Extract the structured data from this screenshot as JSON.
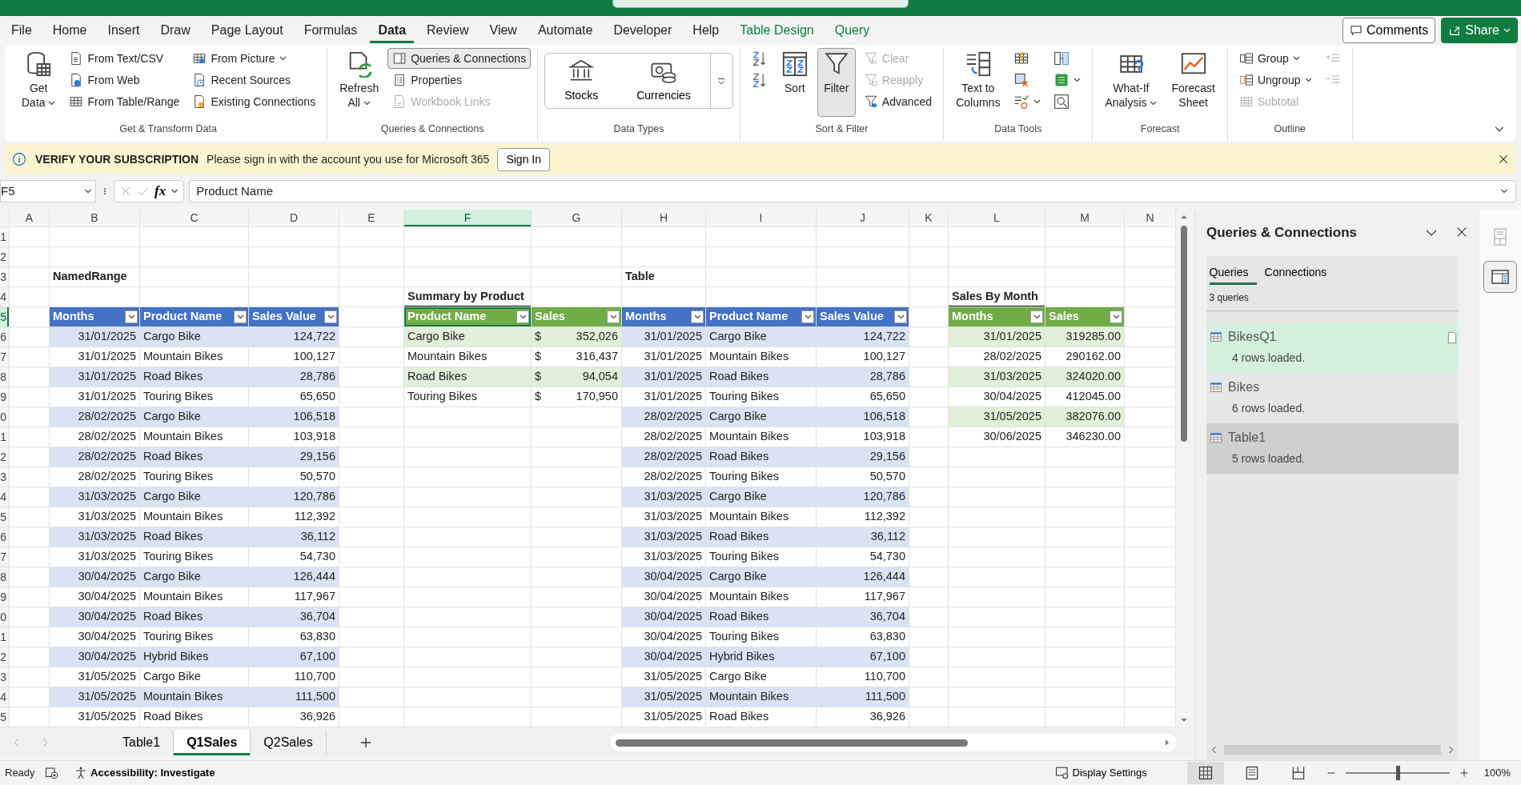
{
  "ribbon_tabs": [
    {
      "label": "File",
      "selected": false,
      "kind": "main"
    },
    {
      "label": "Home",
      "selected": false,
      "kind": "main"
    },
    {
      "label": "Insert",
      "selected": false,
      "kind": "main"
    },
    {
      "label": "Draw",
      "selected": false,
      "kind": "main"
    },
    {
      "label": "Page Layout",
      "selected": false,
      "kind": "main"
    },
    {
      "label": "Formulas",
      "selected": false,
      "kind": "main"
    },
    {
      "label": "Data",
      "selected": true,
      "kind": "main"
    },
    {
      "label": "Review",
      "selected": false,
      "kind": "main"
    },
    {
      "label": "View",
      "selected": false,
      "kind": "main"
    },
    {
      "label": "Automate",
      "selected": false,
      "kind": "main"
    },
    {
      "label": "Developer",
      "selected": false,
      "kind": "main"
    },
    {
      "label": "Help",
      "selected": false,
      "kind": "main"
    },
    {
      "label": "Table Design",
      "selected": false,
      "kind": "contextual"
    },
    {
      "label": "Query",
      "selected": false,
      "kind": "contextual"
    }
  ],
  "header_buttons": [
    {
      "label": "Comments",
      "kind": "outline"
    },
    {
      "label": "Share",
      "kind": "primary"
    }
  ],
  "ribbon_groups": [
    {
      "label": "Get & Transform Data",
      "items": [
        {
          "kind": "large",
          "lines": [
            "Get",
            "Data"
          ],
          "dropdown": true,
          "disabled": false,
          "pressed": false
        },
        {
          "kind": "small",
          "label": "From Text/CSV",
          "dropdown": false,
          "disabled": false,
          "pressed": false
        },
        {
          "kind": "small",
          "label": "From Web",
          "dropdown": false,
          "disabled": false,
          "pressed": false
        },
        {
          "kind": "small",
          "label": "From Table/Range",
          "dropdown": false,
          "disabled": false,
          "pressed": false
        },
        {
          "kind": "small",
          "label": "From Picture",
          "dropdown": true,
          "disabled": false,
          "pressed": false
        },
        {
          "kind": "small",
          "label": "Recent Sources",
          "dropdown": false,
          "disabled": false,
          "pressed": false
        },
        {
          "kind": "small",
          "label": "Existing Connections",
          "dropdown": false,
          "disabled": false,
          "pressed": false
        }
      ]
    },
    {
      "label": "Queries & Connections",
      "items": [
        {
          "kind": "large",
          "lines": [
            "Refresh",
            "All"
          ],
          "dropdown": true,
          "disabled": false,
          "pressed": false
        },
        {
          "kind": "small",
          "label": "Queries & Connections",
          "dropdown": false,
          "disabled": false,
          "pressed": true
        },
        {
          "kind": "small",
          "label": "Properties",
          "dropdown": false,
          "disabled": false,
          "pressed": false
        },
        {
          "kind": "small",
          "label": "Workbook Links",
          "dropdown": false,
          "disabled": true,
          "pressed": false
        }
      ]
    },
    {
      "label": "Data Types",
      "items": [
        {
          "kind": "tile",
          "label": "Stocks"
        },
        {
          "kind": "tile",
          "label": "Currencies"
        },
        {
          "kind": "more"
        }
      ]
    },
    {
      "label": "Sort & Filter",
      "items": [
        {
          "kind": "icon",
          "dropdown": false,
          "disabled": false,
          "pressed": false
        },
        {
          "kind": "icon",
          "dropdown": false,
          "disabled": false,
          "pressed": false
        },
        {
          "kind": "large",
          "lines": [
            "Sort"
          ],
          "dropdown": false,
          "disabled": false,
          "pressed": false
        },
        {
          "kind": "large",
          "lines": [
            "Filter"
          ],
          "dropdown": false,
          "disabled": false,
          "pressed": true
        },
        {
          "kind": "small",
          "label": "Clear",
          "dropdown": false,
          "disabled": true,
          "pressed": false
        },
        {
          "kind": "small",
          "label": "Reapply",
          "dropdown": false,
          "disabled": true,
          "pressed": false
        },
        {
          "kind": "small",
          "label": "Advanced",
          "dropdown": false,
          "disabled": false,
          "pressed": false
        }
      ]
    },
    {
      "label": "Data Tools",
      "items": [
        {
          "kind": "large",
          "lines": [
            "Text to",
            "Columns"
          ],
          "dropdown": false,
          "disabled": false,
          "pressed": false
        },
        {
          "kind": "icon",
          "dropdown": false,
          "disabled": false,
          "pressed": false
        },
        {
          "kind": "icon",
          "dropdown": false,
          "disabled": false,
          "pressed": false
        },
        {
          "kind": "icon",
          "dropdown": true,
          "disabled": false,
          "pressed": false
        },
        {
          "kind": "icon",
          "dropdown": false,
          "disabled": false,
          "pressed": false
        },
        {
          "kind": "icon",
          "dropdown": true,
          "disabled": false,
          "pressed": false
        },
        {
          "kind": "icon",
          "dropdown": false,
          "disabled": false,
          "pressed": false
        }
      ]
    },
    {
      "label": "Forecast",
      "items": [
        {
          "kind": "large",
          "lines": [
            "What-If",
            "Analysis"
          ],
          "dropdown": true,
          "disabled": false,
          "pressed": false
        },
        {
          "kind": "large",
          "lines": [
            "Forecast",
            "Sheet"
          ],
          "dropdown": false,
          "disabled": false,
          "pressed": false
        }
      ]
    },
    {
      "label": "Outline",
      "items": [
        {
          "kind": "small",
          "label": "Group",
          "dropdown": true,
          "disabled": false,
          "pressed": false
        },
        {
          "kind": "small",
          "label": "Ungroup",
          "dropdown": true,
          "disabled": false,
          "pressed": false
        },
        {
          "kind": "small",
          "label": "Subtotal",
          "dropdown": false,
          "disabled": true,
          "pressed": false
        },
        {
          "kind": "icon",
          "dropdown": false,
          "disabled": true,
          "pressed": false
        },
        {
          "kind": "icon",
          "dropdown": false,
          "disabled": true,
          "pressed": false
        }
      ]
    }
  ],
  "message_bar": {
    "title": "VERIFY YOUR SUBSCRIPTION",
    "text": "Please sign in with the account you use for Microsoft 365",
    "button": "Sign In"
  },
  "formula_bar": {
    "name_box": "F5",
    "fx": "fx",
    "content": "Product Name"
  },
  "column_headers": [
    {
      "label": "A",
      "selected": false
    },
    {
      "label": "B",
      "selected": false
    },
    {
      "label": "C",
      "selected": false
    },
    {
      "label": "D",
      "selected": false
    },
    {
      "label": "E",
      "selected": false
    },
    {
      "label": "F",
      "selected": true
    },
    {
      "label": "G",
      "selected": false
    },
    {
      "label": "H",
      "selected": false
    },
    {
      "label": "I",
      "selected": false
    },
    {
      "label": "J",
      "selected": false
    },
    {
      "label": "K",
      "selected": false
    },
    {
      "label": "L",
      "selected": false
    },
    {
      "label": "M",
      "selected": false
    },
    {
      "label": "N",
      "selected": false
    }
  ],
  "row_headers": [
    {
      "label": "1",
      "selected": false
    },
    {
      "label": "2",
      "selected": false
    },
    {
      "label": "3",
      "selected": false
    },
    {
      "label": "4",
      "selected": false
    },
    {
      "label": "5",
      "selected": true
    },
    {
      "label": "6",
      "selected": false
    },
    {
      "label": "7",
      "selected": false
    },
    {
      "label": "8",
      "selected": false
    },
    {
      "label": "9",
      "selected": false
    },
    {
      "label": "0",
      "selected": false
    },
    {
      "label": "1",
      "selected": false
    },
    {
      "label": "2",
      "selected": false
    },
    {
      "label": "3",
      "selected": false
    },
    {
      "label": "4",
      "selected": false
    },
    {
      "label": "5",
      "selected": false
    },
    {
      "label": "6",
      "selected": false
    },
    {
      "label": "7",
      "selected": false
    },
    {
      "label": "8",
      "selected": false
    },
    {
      "label": "9",
      "selected": false
    },
    {
      "label": "0",
      "selected": false
    },
    {
      "label": "1",
      "selected": false
    },
    {
      "label": "2",
      "selected": false
    },
    {
      "label": "3",
      "selected": false
    },
    {
      "label": "4",
      "selected": false
    },
    {
      "label": "5",
      "selected": false
    }
  ],
  "tables": [
    {
      "title": "NamedRange",
      "title_underlined": false,
      "color": "#4472c4",
      "columns": [
        {
          "label": "Months"
        },
        {
          "label": "Product Name"
        },
        {
          "label": "Sales Value"
        }
      ],
      "rows": [
        [
          "31/01/2025",
          "Cargo Bike",
          "124,722"
        ],
        [
          "31/01/2025",
          "Mountain Bikes",
          "100,127"
        ],
        [
          "31/01/2025",
          "Road Bikes",
          "28,786"
        ],
        [
          "31/01/2025",
          "Touring Bikes",
          "65,650"
        ],
        [
          "28/02/2025",
          "Cargo Bike",
          "106,518"
        ],
        [
          "28/02/2025",
          "Mountain Bikes",
          "103,918"
        ],
        [
          "28/02/2025",
          "Road Bikes",
          "29,156"
        ],
        [
          "28/02/2025",
          "Touring Bikes",
          "50,570"
        ],
        [
          "31/03/2025",
          "Cargo Bike",
          "120,786"
        ],
        [
          "31/03/2025",
          "Mountain Bikes",
          "112,392"
        ],
        [
          "31/03/2025",
          "Road Bikes",
          "36,112"
        ],
        [
          "31/03/2025",
          "Touring Bikes",
          "54,730"
        ],
        [
          "30/04/2025",
          "Cargo Bike",
          "126,444"
        ],
        [
          "30/04/2025",
          "Mountain Bikes",
          "117,967"
        ],
        [
          "30/04/2025",
          "Road Bikes",
          "36,704"
        ],
        [
          "30/04/2025",
          "Touring Bikes",
          "63,830"
        ],
        [
          "30/04/2025",
          "Hybrid Bikes",
          "67,100"
        ],
        [
          "31/05/2025",
          "Cargo Bike",
          "110,700"
        ],
        [
          "31/05/2025",
          "Mountain Bikes",
          "111,500"
        ],
        [
          "31/05/2025",
          "Road Bikes",
          "36,926"
        ]
      ]
    },
    {
      "title": "Summary by Product",
      "title_underlined": true,
      "color": "#70ad47",
      "columns": [
        {
          "label": "Product Name"
        },
        {
          "label": "Sales"
        }
      ],
      "rows": [
        [
          "Cargo Bike",
          {
            "currency": "$",
            "amount": "352,026"
          }
        ],
        [
          "Mountain Bikes",
          {
            "currency": "$",
            "amount": "316,437"
          }
        ],
        [
          "Road Bikes",
          {
            "currency": "$",
            "amount": "94,054"
          }
        ],
        [
          "Touring Bikes",
          {
            "currency": "$",
            "amount": "170,950"
          }
        ]
      ]
    },
    {
      "title": "Table",
      "title_underlined": false,
      "color": "#4472c4",
      "columns": [
        {
          "label": "Months"
        },
        {
          "label": "Product Name"
        },
        {
          "label": "Sales Value"
        }
      ],
      "rows": [
        [
          "31/01/2025",
          "Cargo Bike",
          "124,722"
        ],
        [
          "31/01/2025",
          "Mountain Bikes",
          "100,127"
        ],
        [
          "31/01/2025",
          "Road Bikes",
          "28,786"
        ],
        [
          "31/01/2025",
          "Touring Bikes",
          "65,650"
        ],
        [
          "28/02/2025",
          "Cargo Bike",
          "106,518"
        ],
        [
          "28/02/2025",
          "Mountain Bikes",
          "103,918"
        ],
        [
          "28/02/2025",
          "Road Bikes",
          "29,156"
        ],
        [
          "28/02/2025",
          "Touring Bikes",
          "50,570"
        ],
        [
          "31/03/2025",
          "Cargo Bike",
          "120,786"
        ],
        [
          "31/03/2025",
          "Mountain Bikes",
          "112,392"
        ],
        [
          "31/03/2025",
          "Road Bikes",
          "36,112"
        ],
        [
          "31/03/2025",
          "Touring Bikes",
          "54,730"
        ],
        [
          "30/04/2025",
          "Cargo Bike",
          "126,444"
        ],
        [
          "30/04/2025",
          "Mountain Bikes",
          "117,967"
        ],
        [
          "30/04/2025",
          "Road Bikes",
          "36,704"
        ],
        [
          "30/04/2025",
          "Touring Bikes",
          "63,830"
        ],
        [
          "30/04/2025",
          "Hybrid Bikes",
          "67,100"
        ],
        [
          "31/05/2025",
          "Cargo Bike",
          "110,700"
        ],
        [
          "31/05/2025",
          "Mountain Bikes",
          "111,500"
        ],
        [
          "31/05/2025",
          "Road Bikes",
          "36,926"
        ]
      ]
    },
    {
      "title": "Sales By Month",
      "title_underlined": true,
      "color": "#70ad47",
      "columns": [
        {
          "label": "Months"
        },
        {
          "label": "Sales"
        }
      ],
      "rows": [
        [
          "31/01/2025",
          "319285.00"
        ],
        [
          "28/02/2025",
          "290162.00"
        ],
        [
          "31/03/2025",
          "324020.00"
        ],
        [
          "30/04/2025",
          "412045.00"
        ],
        [
          "31/05/2025",
          "382076.00"
        ],
        [
          "30/06/2025",
          "346230.00"
        ]
      ]
    }
  ],
  "sheet_tabs": [
    {
      "label": "Table1",
      "selected": false
    },
    {
      "label": "Q1Sales",
      "selected": true
    },
    {
      "label": "Q2Sales",
      "selected": false
    }
  ],
  "queries_pane": {
    "title": "Queries & Connections",
    "tabs": [
      {
        "label": "Queries",
        "selected": true
      },
      {
        "label": "Connections",
        "selected": false
      }
    ],
    "count": "3 queries",
    "items": [
      {
        "name": "BikesQ1",
        "status": "4 rows loaded.",
        "selected": true,
        "hovered": false
      },
      {
        "name": "Bikes",
        "status": "6 rows loaded.",
        "selected": false,
        "hovered": false
      },
      {
        "name": "Table1",
        "status": "5 rows loaded.",
        "selected": false,
        "hovered": true
      }
    ]
  },
  "side_strip": [
    {
      "selected": false
    },
    {
      "selected": true
    }
  ],
  "status_bar": {
    "ready": "Ready",
    "accessibility": "Accessibility: Investigate",
    "display_settings": "Display Settings",
    "views": [
      {
        "selected": true
      },
      {
        "selected": false
      },
      {
        "selected": false
      }
    ],
    "zoom": {
      "level": 0.5,
      "reading": "100%"
    }
  }
}
